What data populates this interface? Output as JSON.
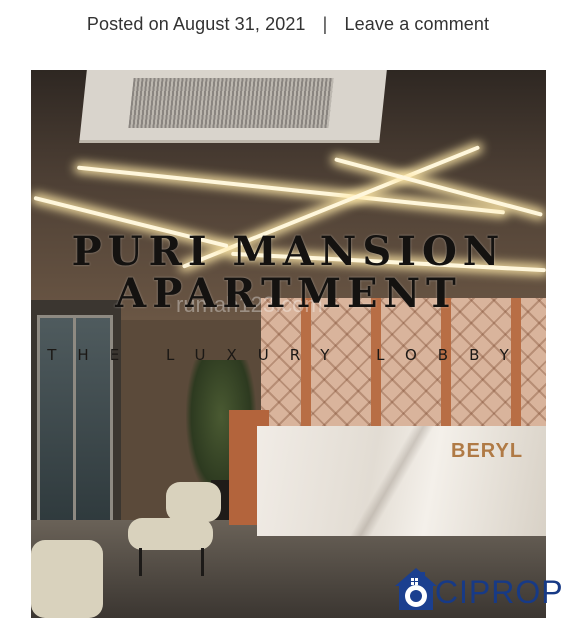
{
  "post_meta": {
    "posted_on_label": "Posted on",
    "date": "August 31, 2021",
    "separator": "|",
    "comment_link": "Leave a comment"
  },
  "featured_image": {
    "title_line_1": "PURI MANSION",
    "title_line_2": "APARTMENT",
    "subtitle": "THE LUXURY LOBBY",
    "brand_sign": "BERYL",
    "watermark": "rumah123.com"
  },
  "logo": {
    "text_first": "O",
    "text_rest": "CIPROP",
    "color": "#1b3f8f"
  }
}
